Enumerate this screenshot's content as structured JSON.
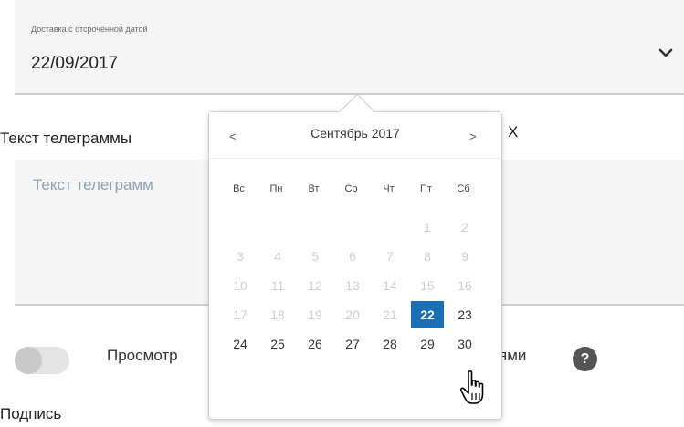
{
  "date_field": {
    "label": "Доставка с отсроченной датой",
    "value": "22/09/2017",
    "icon": "chevron-down-icon"
  },
  "telegram": {
    "label": "Текст телеграммы",
    "counter": "X",
    "placeholder": "Текст телеграмм"
  },
  "preview": {
    "label_start": "Просмотр",
    "label_end": "ями",
    "help": "?"
  },
  "signature": {
    "label": "Подпись"
  },
  "calendar": {
    "prev": "<",
    "next": ">",
    "title": "Сентябрь 2017",
    "weekdays": [
      "Вс",
      "Пн",
      "Вт",
      "Ср",
      "Чт",
      "Пт",
      "Сб"
    ],
    "selected_day": "22",
    "selected_color": "#1a6fb5",
    "weeks": [
      [
        "",
        "",
        "",
        "",
        "",
        "1",
        "2"
      ],
      [
        "3",
        "4",
        "5",
        "6",
        "7",
        "8",
        "9"
      ],
      [
        "10",
        "11",
        "12",
        "13",
        "14",
        "15",
        "16"
      ],
      [
        "17",
        "18",
        "19",
        "20",
        "21",
        "22",
        "23"
      ],
      [
        "24",
        "25",
        "26",
        "27",
        "28",
        "29",
        "30"
      ]
    ],
    "enabled_days": [
      "22",
      "23",
      "24",
      "25",
      "26",
      "27",
      "28",
      "29",
      "30"
    ]
  }
}
